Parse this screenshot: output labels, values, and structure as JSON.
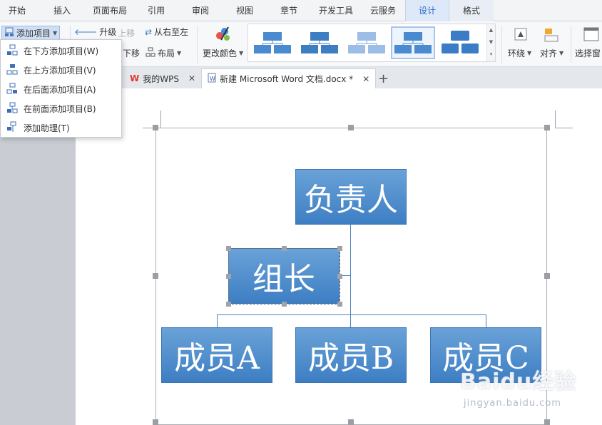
{
  "menu_tabs": [
    {
      "label": "开始"
    },
    {
      "label": "插入"
    },
    {
      "label": "页面布局"
    },
    {
      "label": "引用"
    },
    {
      "label": "审阅"
    },
    {
      "label": "视图"
    },
    {
      "label": "章节"
    },
    {
      "label": "开发工具"
    },
    {
      "label": "云服务"
    },
    {
      "label": "设计"
    },
    {
      "label": "格式"
    }
  ],
  "ribbon": {
    "add_item": "添加项目",
    "promote": "升级",
    "move_up": "上移",
    "right_to_left": "从右至左",
    "move_down": "下移",
    "layout": "布局",
    "change_colors": "更改颜色",
    "wrap": "环绕",
    "align": "对齐",
    "selection_pane": "选择窗"
  },
  "dropdown": [
    {
      "label": "在下方添加项目(W)"
    },
    {
      "label": "在上方添加项目(V)"
    },
    {
      "label": "在后面添加项目(A)"
    },
    {
      "label": "在前面添加项目(B)"
    },
    {
      "label": "添加助理(T)"
    }
  ],
  "doc_tabs": [
    {
      "label": "我的WPS"
    },
    {
      "label": "新建 Microsoft Word 文档.docx *"
    }
  ],
  "org_chart": {
    "top": "负责人",
    "assistant": "组长",
    "members": [
      "成员A",
      "成员B",
      "成员C"
    ]
  },
  "watermark": {
    "brand": "Baidu经验",
    "url": "jingyan.baidu.com"
  },
  "colors": {
    "accent": "#2a6bd1",
    "node_fill": "#4a8ad0",
    "wps_red": "#e03a2f"
  }
}
